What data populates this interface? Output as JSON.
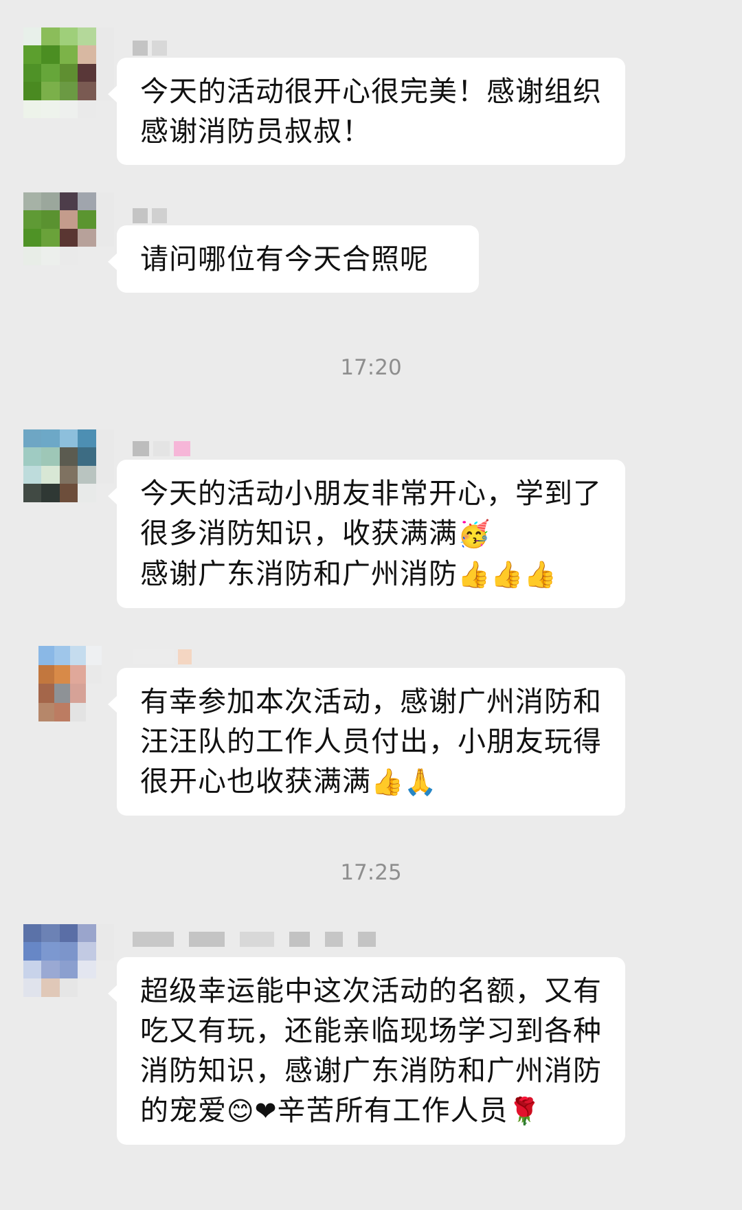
{
  "colors": {
    "background": "#ebebeb",
    "bubble": "#ffffff",
    "text": "#111111",
    "timestamp": "#8e8e8e"
  },
  "timestamps": [
    "17:20",
    "17:25"
  ],
  "messages": [
    {
      "sender": "",
      "text": "今天的活动很开心很完美！感谢组织感谢消防员叔叔！"
    },
    {
      "sender": "",
      "text": "请问哪位有今天合照呢"
    },
    {
      "sender": "",
      "text": "今天的活动小朋友非常开心，学到了很多消防知识，收获满满",
      "emoji_after_text": "🥳",
      "text2": "感谢广东消防和广州消防",
      "emoji_after_text2": "👍👍👍"
    },
    {
      "sender": "",
      "text": "有幸参加本次活动，感谢广州消防和汪汪队的工作人员付出，小朋友玩得很开心也收获满满",
      "emoji_after_text": "👍🙏"
    },
    {
      "sender": "",
      "text": "超级幸运能中这次活动的名额，又有吃又有玩，还能亲临现场学习到各种消防知识，感谢广东消防和广州消防的宠爱",
      "emoji_after_text": "😊❤",
      "text2": "辛苦所有工作人员",
      "emoji_after_text2": "🌹"
    }
  ]
}
